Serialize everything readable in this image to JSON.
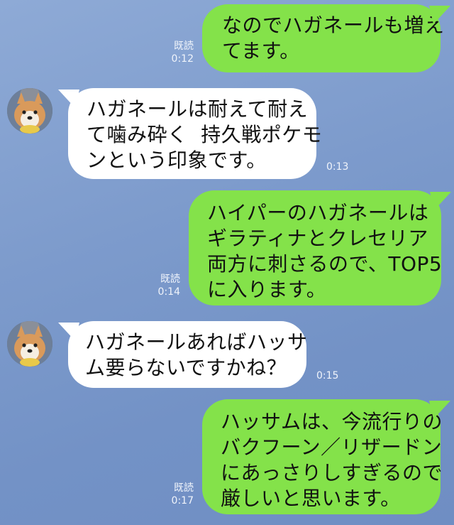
{
  "messages": [
    {
      "side": "sent",
      "text": "なのでハガネールも増え\nてます。",
      "read": "既読",
      "time": "0:12"
    },
    {
      "side": "recv",
      "text": "ハガネールは耐えて耐え\nて噛み砕く  持久戦ポケモ\nンという印象です。",
      "time": "0:13",
      "avatar": "corgi-avatar"
    },
    {
      "side": "sent",
      "text": "ハイパーのハガネールは\nギラティナとクレセリア\n両方に刺さるので、TOP5\nに入ります。",
      "read": "既読",
      "time": "0:14"
    },
    {
      "side": "recv",
      "text": "ハガネールあればハッサ\nム要らないですかね？",
      "time": "0:15",
      "avatar": "corgi-avatar"
    },
    {
      "side": "sent",
      "text": "ハッサムは、今流行りの\nバクフーン／リザードン\nにあっさりしすぎるので\n厳しいと思います。",
      "read": "既読",
      "time": "0:17"
    }
  ],
  "colors": {
    "sent_bubble": "#84e24a",
    "recv_bubble": "#ffffff",
    "background": "#7d9bcc"
  }
}
